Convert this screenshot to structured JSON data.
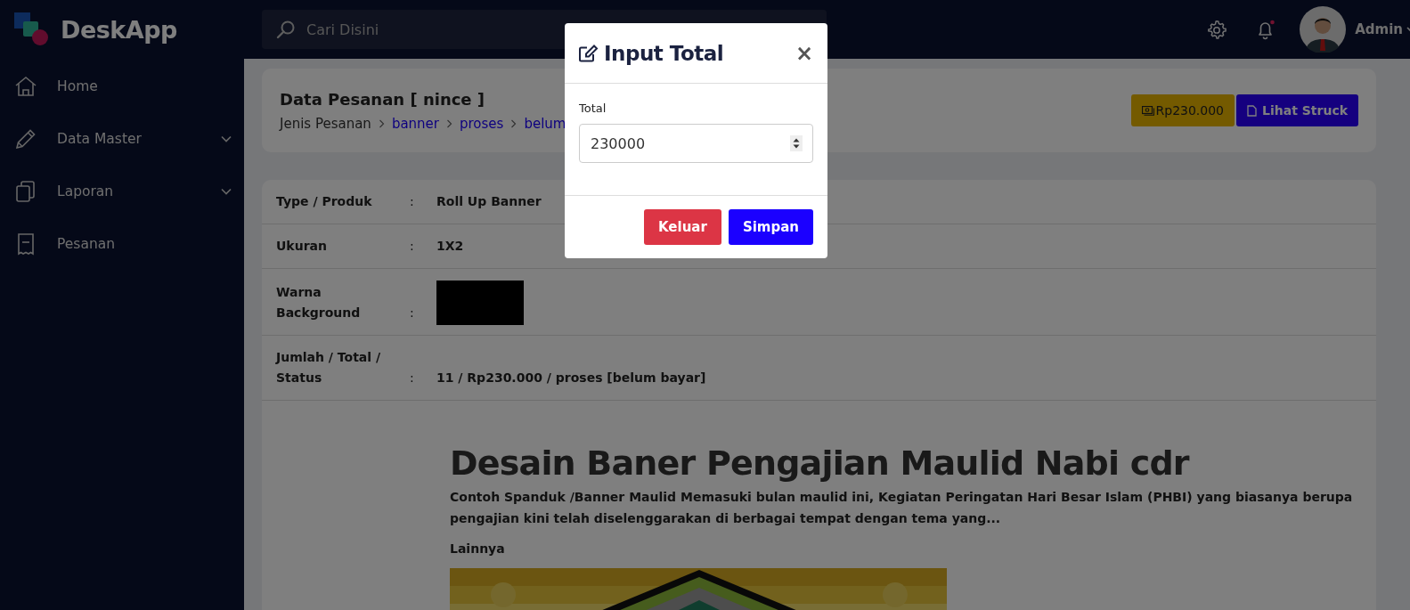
{
  "brand": "DeskApp",
  "search": {
    "placeholder": "Cari Disini"
  },
  "user": {
    "name": "Admin"
  },
  "sidebar": {
    "items": [
      {
        "label": "Home",
        "expandable": false
      },
      {
        "label": "Data Master",
        "expandable": true
      },
      {
        "label": "Laporan",
        "expandable": true
      },
      {
        "label": "Pesanan",
        "expandable": false
      }
    ]
  },
  "page_header": {
    "title": "Data Pesanan [ nince ]",
    "breadcrumb": [
      {
        "label": "Jenis Pesanan",
        "link": false
      },
      {
        "label": "banner",
        "link": true
      },
      {
        "label": "proses",
        "link": true
      },
      {
        "label": "belum",
        "link": true
      }
    ],
    "total_badge": "Rp230.000",
    "receipt_button": "Lihat Struck"
  },
  "details": [
    {
      "kind": "text",
      "label": "Type / Produk",
      "separator": ":",
      "value": "Roll Up Banner"
    },
    {
      "kind": "text",
      "label": "Ukuran",
      "separator": ":",
      "value": "1X2"
    },
    {
      "kind": "swatch",
      "label": "Warna Background",
      "separator": ":",
      "color": "#000000"
    },
    {
      "kind": "text",
      "label": "Jumlah / Total / Status",
      "separator": ":",
      "value": "11 / Rp230.000 / proses [belum bayar]"
    }
  ],
  "article": {
    "title": "Desain Baner Pengajian Maulid Nabi cdr",
    "text": "Contoh Spanduk /Banner Maulid Memasuki bulan maulid ini, Kegiatan Peringatan Hari Besar Islam (PHBI) yang biasanya berupa pengajian kini telah diselenggarakan di berbagai tempat dengan tema yang...",
    "more": "Lainnya"
  },
  "modal": {
    "title": "Input Total",
    "close": "×",
    "field_label": "Total",
    "value": "230000",
    "buttons": [
      {
        "label": "Keluar",
        "kind": "danger"
      },
      {
        "label": "Simpan",
        "kind": "primary"
      }
    ]
  }
}
